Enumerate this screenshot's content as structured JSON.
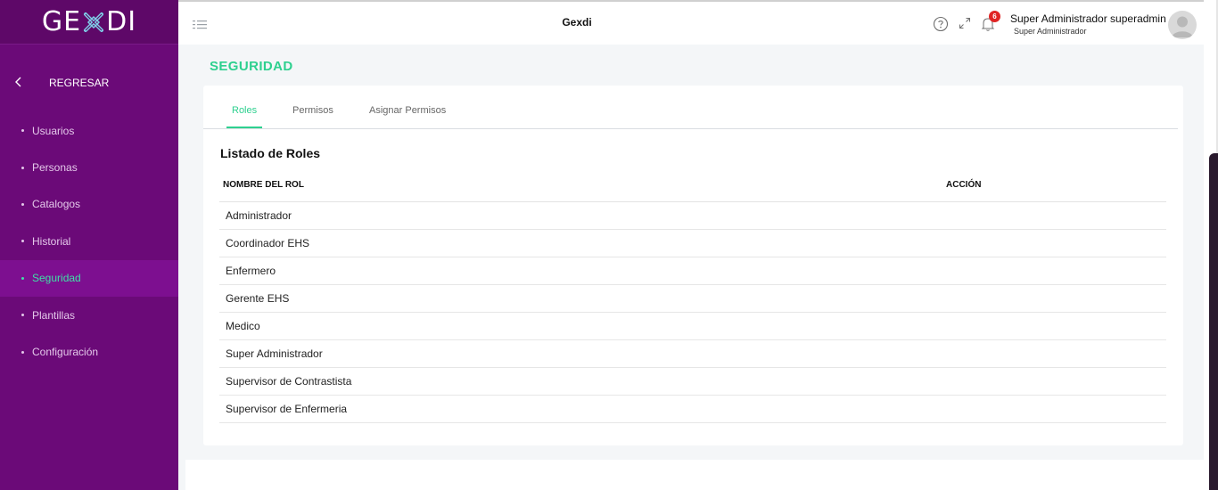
{
  "sidebar": {
    "logo_text_left": "GE",
    "logo_text_right": "DI",
    "back_label": "REGRESAR",
    "items": [
      {
        "label": "Usuarios"
      },
      {
        "label": "Personas"
      },
      {
        "label": "Catalogos"
      },
      {
        "label": "Historial"
      },
      {
        "label": "Seguridad",
        "active": true
      },
      {
        "label": "Plantillas"
      },
      {
        "label": "Configuración"
      }
    ]
  },
  "header": {
    "app_title": "Gexdi",
    "notifications_count": "6",
    "user_name": "Super Administrador superadmin",
    "user_role": "Super Administrador",
    "icons": [
      "menu-icon",
      "help-icon",
      "fullscreen-icon",
      "bell-icon",
      "avatar"
    ]
  },
  "main": {
    "page_title": "SEGURIDAD",
    "tabs": [
      {
        "label": "Roles",
        "active": true
      },
      {
        "label": "Permisos"
      },
      {
        "label": "Asignar Permisos"
      }
    ],
    "section_title": "Listado de Roles",
    "table": {
      "columns": [
        "NOMBRE DEL ROL",
        "ACCIÓN"
      ],
      "rows": [
        "Administrador",
        "Coordinador EHS",
        "Enfermero",
        "Gerente EHS",
        "Medico",
        "Super Administrador",
        "Supervisor de Contrastista",
        "Supervisor de Enfermeria"
      ]
    }
  },
  "colors": {
    "sidebar_bg": "#6b0a78",
    "sidebar_active": "#7d0f90",
    "accent": "#2ed08f",
    "badge": "#e02424"
  }
}
